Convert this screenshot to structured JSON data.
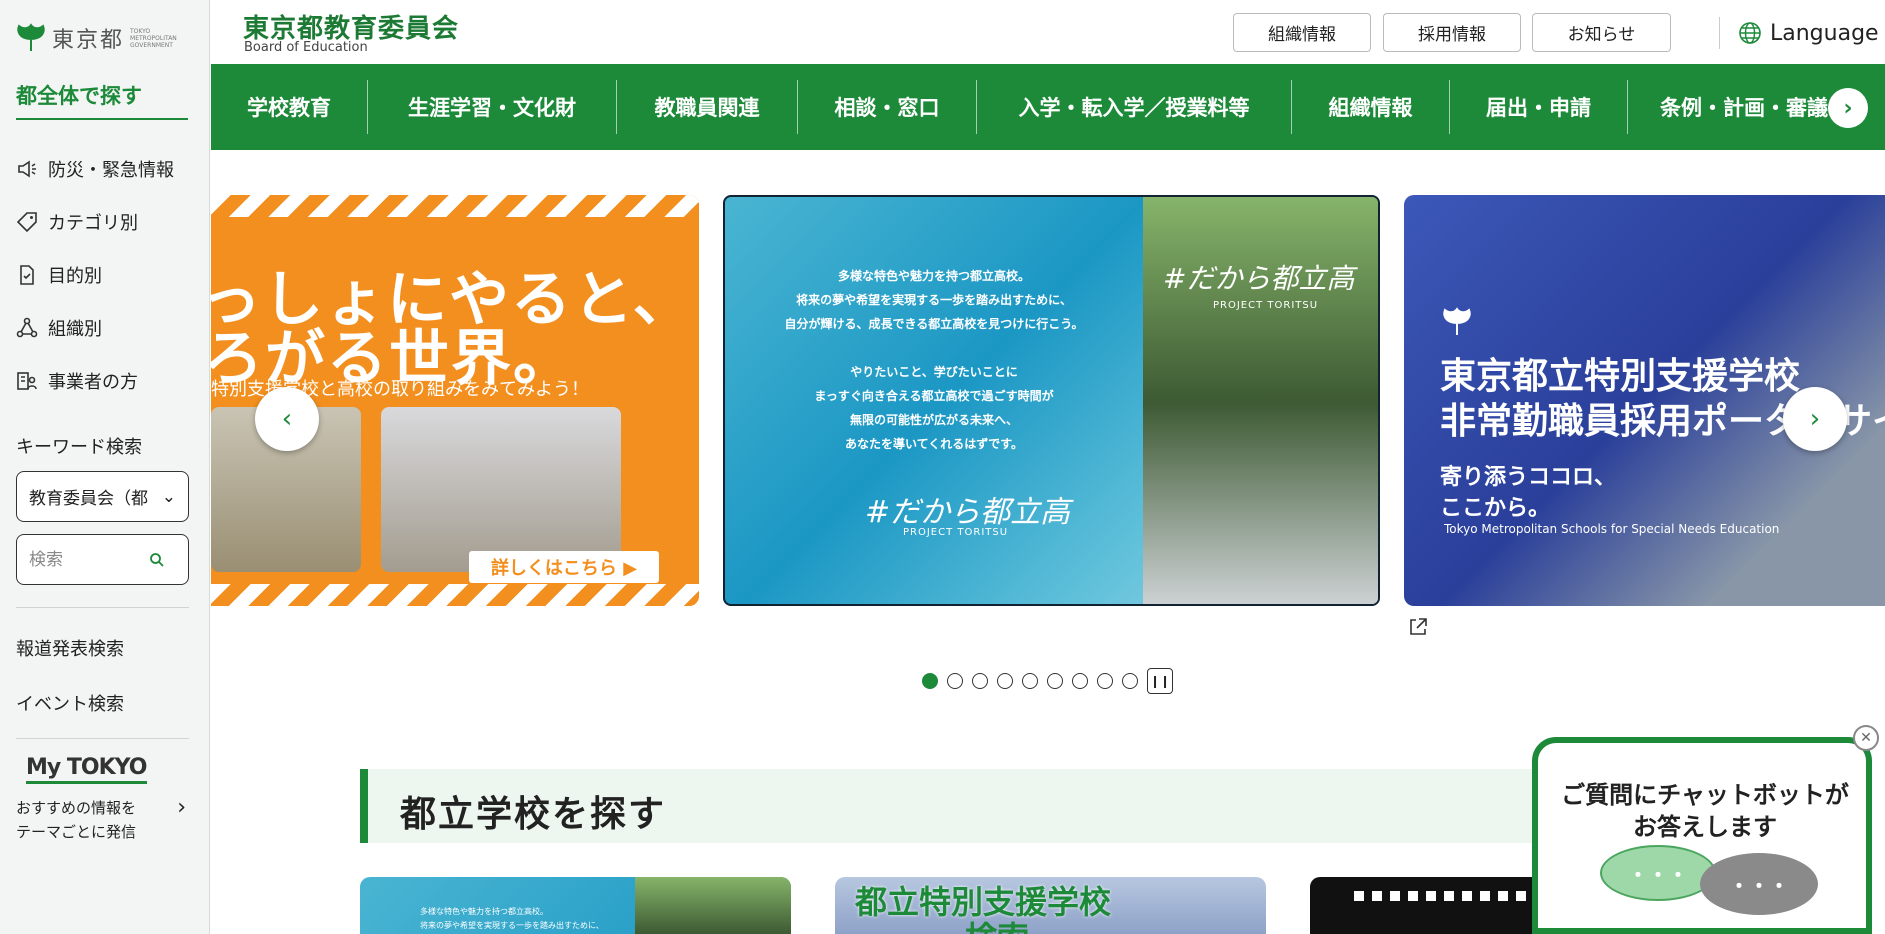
{
  "sidebar": {
    "logo_name": "東京都",
    "logo_sub": "TOKYO METROPOLITAN GOVERNMENT",
    "heading": "都全体で探す",
    "items": [
      {
        "label": "防災・緊急情報",
        "icon": "megaphone-icon"
      },
      {
        "label": "カテゴリ別",
        "icon": "tag-icon"
      },
      {
        "label": "目的別",
        "icon": "document-check-icon"
      },
      {
        "label": "組織別",
        "icon": "org-chart-icon"
      },
      {
        "label": "事業者の方",
        "icon": "business-person-icon"
      }
    ],
    "keyword_label": "キーワード検索",
    "scope_select": "教育委員会（都",
    "search_placeholder": "検索",
    "press_link": "報道発表検索",
    "event_link": "イベント検索",
    "mytokyo_logo": "My TOKYO",
    "mytokyo_desc_1": "おすすめの情報を",
    "mytokyo_desc_2": "テーマごとに発信"
  },
  "header": {
    "title": "東京都教育委員会",
    "subtitle": "Board of Education",
    "buttons": [
      "組織情報",
      "採用情報",
      "お知らせ"
    ],
    "language": "Language"
  },
  "nav": [
    "学校教育",
    "生涯学習・文化財",
    "教職員関連",
    "相談・窓口",
    "入学・転入学／授業料等",
    "組織情報",
    "届出・申請",
    "条例・計画・審議"
  ],
  "carousel": {
    "slide1": {
      "line1": "っしょにやると、",
      "line2": "ろがる世界。",
      "line3": "特別支援学校と高校の取り組みをみてみよう！",
      "more": "詳しくはこちら ▶"
    },
    "slide2": {
      "text_lines": [
        "多様な特色や魅力を持つ都立高校。",
        "将来の夢や希望を実現する一歩を踏み出すために、",
        "自分が輝ける、成長できる都立高校を見つけに行こう。",
        "",
        "やりたいこと、学びたいことに",
        "まっすぐ向き合える都立高校で過ごす時間が",
        "無限の可能性が広がる未来へ、",
        "あなたを導いてくれるはずです。"
      ],
      "hashtag": "#だから都立高",
      "project": "PROJECT TORITSU"
    },
    "slide3": {
      "title_1": "東京都立特別支援学校",
      "title_2": "非常勤職員採用ポータルサイト",
      "sub_1": "寄り添うココロ、",
      "sub_2": "ここから。",
      "en": "Tokyo Metropolitan Schools for Special Needs Education"
    },
    "dots_total": 9,
    "active_dot": 1
  },
  "section": {
    "title": "都立学校を探す",
    "card2_title_1": "都立特別支援学校",
    "card2_title_2": "検索",
    "card1_text_1": "多様な特色や魅力を持つ都立高校。",
    "card1_text_2": "将来の夢や希望を実現する一歩を踏み出すために、"
  },
  "chatbot": {
    "message_1": "ご質問にチャットボットが",
    "message_2": "お答えします",
    "bubble": "・・・"
  },
  "colors": {
    "brand_green": "#1d8a3a",
    "orange": "#f38f1e"
  }
}
